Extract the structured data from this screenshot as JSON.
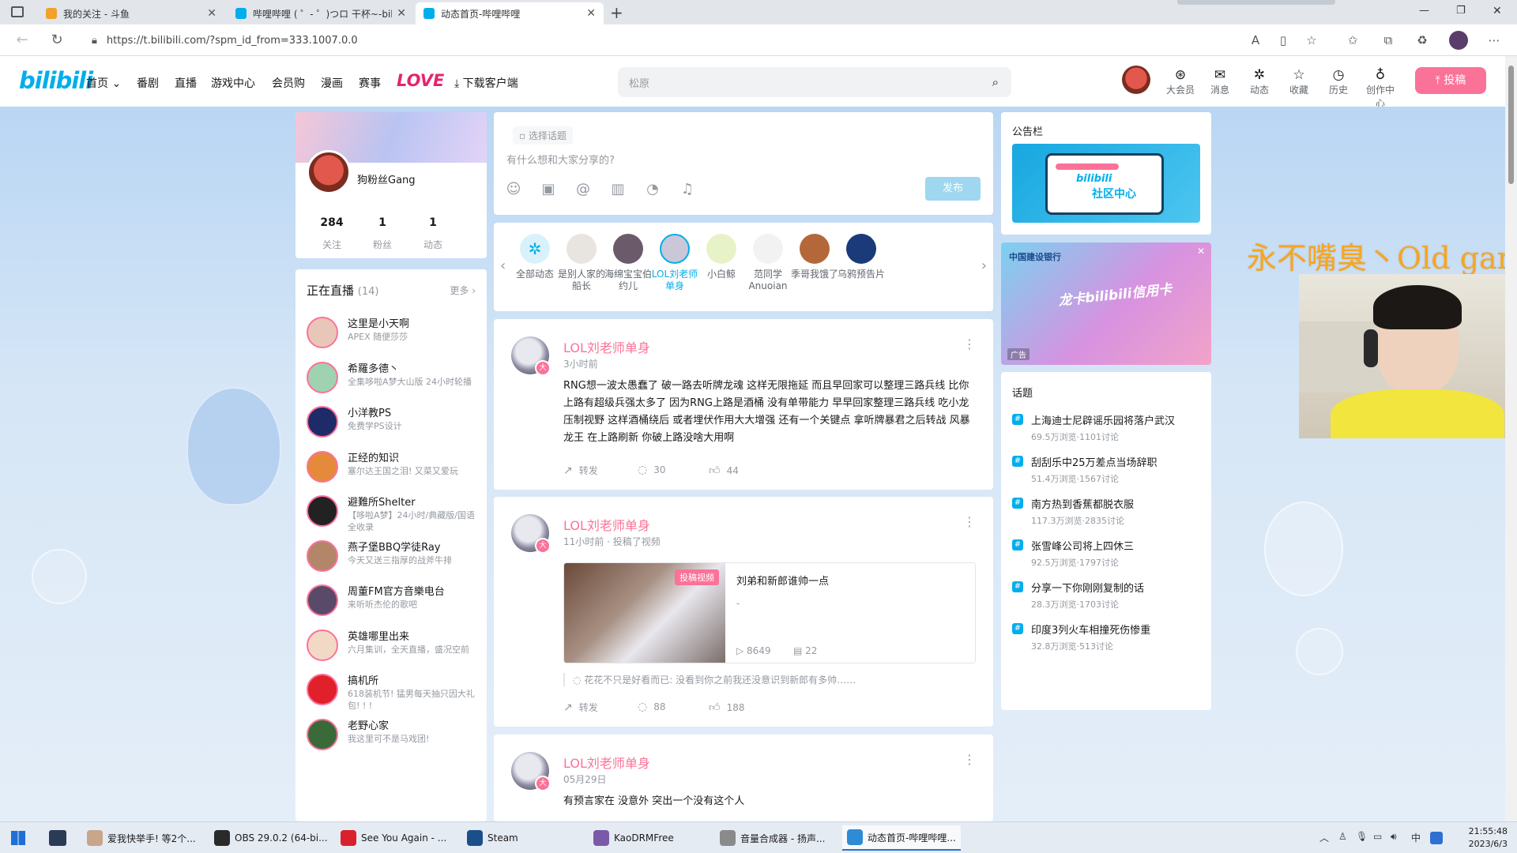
{
  "browser": {
    "tabs": [
      {
        "title": "我的关注 - 斗鱼",
        "active": false
      },
      {
        "title": "哔哩哔哩 ( ゜- ゜)つロ 干杯~-bilibili",
        "active": false
      },
      {
        "title": "动态首页-哔哩哔哩",
        "active": true
      }
    ],
    "new_tab": "+",
    "url": "https://t.bilibili.com/?spm_id_from=333.1007.0.0"
  },
  "header": {
    "logo": "bilibili",
    "nav": [
      "首页",
      "番剧",
      "直播",
      "游戏中心",
      "会员购",
      "漫画",
      "赛事",
      "LOVE",
      "下载客户端"
    ],
    "search_placeholder": "松原",
    "icons": [
      {
        "label": "大会员",
        "icon": "vip-icon",
        "glyph": "⊛"
      },
      {
        "label": "消息",
        "icon": "message-icon",
        "glyph": "✉"
      },
      {
        "label": "动态",
        "icon": "dynamic-icon",
        "glyph": "✲"
      },
      {
        "label": "收藏",
        "icon": "star-icon",
        "glyph": "☆"
      },
      {
        "label": "历史",
        "icon": "history-icon",
        "glyph": "◷"
      },
      {
        "label": "创作中心",
        "icon": "bulb-icon",
        "glyph": "♁"
      }
    ],
    "upload": "投稿"
  },
  "profile": {
    "name": "狗粉丝Gang",
    "stats": [
      {
        "value": "284",
        "label": "关注"
      },
      {
        "value": "1",
        "label": "粉丝"
      },
      {
        "value": "1",
        "label": "动态"
      }
    ]
  },
  "live": {
    "title": "正在直播",
    "count": "(14)",
    "more": "更多 ›",
    "items": [
      {
        "name": "这里是小天啊",
        "desc": "APEX 随便莎莎",
        "color": "#e9c7b8"
      },
      {
        "name": "希羅多德丶",
        "desc": "全集哆啦A梦大山版 24小时轮播",
        "color": "#9fd2b0"
      },
      {
        "name": "小洋教PS",
        "desc": "免费学PS设计",
        "color": "#1f2a68"
      },
      {
        "name": "正经的知识",
        "desc": "塞尔达王国之泪! 又菜又爱玩",
        "color": "#e58a3a"
      },
      {
        "name": "避難所Shelter",
        "desc": "【哆啦A梦】24小时/典藏版/国语全收录",
        "color": "#222222"
      },
      {
        "name": "燕子堡BBQ学徒Ray",
        "desc": "今天又送三指厚的战斧牛排",
        "color": "#b3866a"
      },
      {
        "name": "周董FM官方音樂电台",
        "desc": "来听听杰伦的歌吧",
        "color": "#5a4a6a"
      },
      {
        "name": "英雄哪里出来",
        "desc": "六月集训，全天直播，盛况空前",
        "color": "#f2d9c5"
      },
      {
        "name": "搞机所",
        "desc": "618装机节! 猛男每天抽只因大礼包! ! !",
        "color": "#e0202a"
      },
      {
        "name": "老野心家",
        "desc": "我这里可不是马戏团!",
        "color": "#3a6a3a"
      }
    ]
  },
  "compose": {
    "topic": "选择话题",
    "placeholder": "有什么想和大家分享的?",
    "tools": [
      {
        "icon": "emoji-icon",
        "glyph": "☺"
      },
      {
        "icon": "image-icon",
        "glyph": "▣"
      },
      {
        "icon": "at-icon",
        "glyph": "@"
      },
      {
        "icon": "vote-icon",
        "glyph": "▥"
      },
      {
        "icon": "schedule-icon",
        "glyph": "◔"
      },
      {
        "icon": "lottery-icon",
        "glyph": "♫"
      }
    ],
    "publish": "发布"
  },
  "follow": {
    "items": [
      {
        "name": "全部动态",
        "color": "#d9f1fb"
      },
      {
        "name": "是别人家的船长",
        "color": "#e8e4df"
      },
      {
        "name": "海绵宝宝伯约儿",
        "color": "#6a5a6a"
      },
      {
        "name": "LOL刘老师单身",
        "color": "#c9c7d8"
      },
      {
        "name": "小白鲸",
        "color": "#e8f2c8"
      },
      {
        "name": "范同学Anuoian",
        "color": "#f2f2f2"
      },
      {
        "name": "季哥我饿了",
        "color": "#b4683a"
      },
      {
        "name": "乌鸦预告片",
        "color": "#1a3a7a"
      }
    ]
  },
  "posts": [
    {
      "author": "LOL刘老师单身",
      "time": "3小时前",
      "text": "RNG想一波太愚蠢了  破一路去听牌龙魂 这样无限拖延 而且早回家可以整理三路兵线 比你上路有超级兵强太多了 因为RNG上路是酒桶 没有单带能力 早早回家整理三路兵线 吃小龙 压制视野 这样酒桶绕后 或者埋伏作用大大增强 还有一个关键点 拿听牌暴君之后转战 风暴龙王 在上路刷新 你破上路没啥大用啊",
      "repost": "转发",
      "comments": "30",
      "likes": "44"
    },
    {
      "author": "LOL刘老师单身",
      "time": "11小时前 · 投稿了视频",
      "video": {
        "badge": "投稿视频",
        "title": "刘弟和新郎谁帅一点",
        "desc": "-",
        "views": "8649",
        "danmaku": "22"
      },
      "comment": "花花不只是好看而已: 没看到你之前我还没意识到新郎有多帅……",
      "repost": "转发",
      "comments": "88",
      "likes": "188"
    },
    {
      "author": "LOL刘老师单身",
      "time": "05月29日",
      "text": "有预言家在 没意外 突出一个没有这个人"
    }
  ],
  "notice": {
    "title": "公告栏",
    "banner_logo": "bilibili",
    "banner_text": "社区中心"
  },
  "ad": {
    "bank": "中国建设银行",
    "slogan": "龙卡bilibili信用卡",
    "tag": "广告",
    "close": "✕"
  },
  "topics": {
    "title": "话题",
    "items": [
      {
        "name": "上海迪士尼辟谣乐园将落户武汉",
        "stats": "69.5万浏览·1101讨论"
      },
      {
        "name": "刮刮乐中25万差点当场辞职",
        "stats": "51.4万浏览·1567讨论"
      },
      {
        "name": "南方热到香蕉都脱衣服",
        "stats": "117.3万浏览·2835讨论"
      },
      {
        "name": "张雪峰公司将上四休三",
        "stats": "92.5万浏览·1797讨论"
      },
      {
        "name": "分享一下你刚刚复制的话",
        "stats": "28.3万浏览·1703讨论"
      },
      {
        "name": "印度3列火车相撞死伤惨重",
        "stats": "32.8万浏览·513讨论"
      }
    ]
  },
  "overlay": {
    "watermark": "永不嘴臭丶Old gang"
  },
  "taskbar": {
    "items": [
      {
        "label": "爱我快举手! 等2个...",
        "color": "#c9a58a"
      },
      {
        "label": "OBS 29.0.2 (64-bi...",
        "color": "#2a2a2a"
      },
      {
        "label": "See You Again - ...",
        "color": "#d9212b"
      },
      {
        "label": "Steam",
        "color": "#1b4f8a"
      },
      {
        "label": "KaoDRMFree",
        "color": "#7a5aa8"
      },
      {
        "label": "音量合成器 - 扬声...",
        "color": "#8a8a8a"
      },
      {
        "label": "动态首页-哔哩哔哩...",
        "color": "#2e8bd6"
      }
    ],
    "ime": "中",
    "time": "21:55:48",
    "date": "2023/6/3"
  }
}
